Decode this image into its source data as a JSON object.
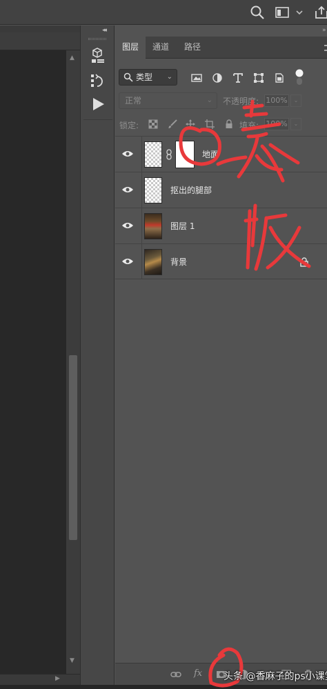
{
  "panel_tabs": [
    {
      "label": "图层",
      "active": true
    },
    {
      "label": "通道",
      "active": false
    },
    {
      "label": "路径",
      "active": false
    }
  ],
  "filter": {
    "kind_label": "类型"
  },
  "blend": {
    "mode_label": "正常",
    "opacity_label": "不透明度:",
    "opacity_value": "100%"
  },
  "lock": {
    "label": "锁定:",
    "fill_label": "填充:",
    "fill_value": "100%"
  },
  "layers": [
    {
      "name": "地面",
      "thumb": "checker",
      "has_mask": true,
      "visible": true,
      "locked": false
    },
    {
      "name": "抠出的腿部",
      "thumb": "checker",
      "has_mask": false,
      "visible": true,
      "locked": false
    },
    {
      "name": "图层 1",
      "thumb": "photo",
      "has_mask": false,
      "visible": true,
      "locked": false
    },
    {
      "name": "背景",
      "thumb": "photo",
      "has_mask": false,
      "visible": true,
      "locked": true
    }
  ],
  "icons": {
    "topbar": [
      "search-icon",
      "workspace-icon",
      "chevron-down-icon",
      "share-icon"
    ],
    "tools": [
      "3d-object-icon",
      "history-icon",
      "play-action-icon"
    ],
    "filters": [
      "image-filter-icon",
      "adjustment-filter-icon",
      "text-filter-icon",
      "shape-filter-icon",
      "smart-object-filter-icon",
      "filter-toggle-icon"
    ],
    "locks": [
      "lock-transparent-icon",
      "lock-paint-icon",
      "lock-position-icon",
      "lock-artboard-icon",
      "lock-all-icon"
    ],
    "footer": [
      "link-layers-icon",
      "fx-icon",
      "add-mask-icon",
      "new-group-icon",
      "new-layer-icon",
      "delete-layer-icon"
    ]
  },
  "watermark": "头条 @香麻子的ps小课堂",
  "annotation_color": "#e8393b"
}
